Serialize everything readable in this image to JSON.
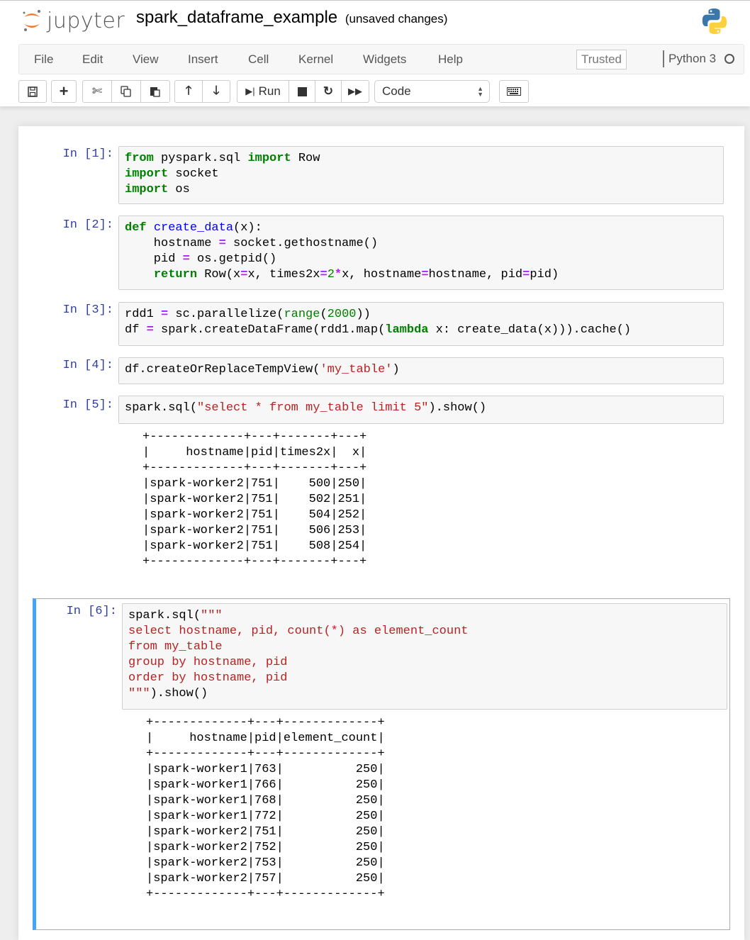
{
  "header": {
    "logo_text": "jupyter",
    "notebook_name": "spark_dataframe_example",
    "save_status": "(unsaved changes)",
    "kernel_logo": "python-logo-icon"
  },
  "menubar": {
    "items": [
      "File",
      "Edit",
      "View",
      "Insert",
      "Cell",
      "Kernel",
      "Widgets",
      "Help"
    ],
    "trusted_label": "Trusted",
    "kernel_name": "Python 3",
    "kernel_status_icon": "kernel-idle-circle-icon"
  },
  "toolbar": {
    "save_icon": "save-icon",
    "insert_icon": "plus-icon",
    "cut_icon": "scissors-icon",
    "copy_icon": "copy-icon",
    "paste_icon": "paste-icon",
    "move_up_icon": "arrow-up-icon",
    "move_down_icon": "arrow-down-icon",
    "run_label": "Run",
    "interrupt_icon": "stop-icon",
    "restart_icon": "restart-icon",
    "run_all_icon": "fast-forward-icon",
    "cell_type": "Code",
    "command_palette_icon": "keyboard-icon"
  },
  "cells": [
    {
      "prompt": "In [1]:",
      "lines": [
        [
          [
            "kw",
            "from"
          ],
          [
            "",
            "  pyspark.sql "
          ],
          [
            "kw",
            "import"
          ],
          [
            "",
            " Row"
          ]
        ],
        [
          [
            "kw",
            "import"
          ],
          [
            "",
            " socket"
          ]
        ],
        [
          [
            "kw",
            "import"
          ],
          [
            "",
            " os"
          ]
        ]
      ]
    },
    {
      "prompt": "In [2]:",
      "lines": [
        [
          [
            "kw",
            "def"
          ],
          [
            "",
            " "
          ],
          [
            "fn",
            "create_data"
          ],
          [
            "",
            "(x):"
          ]
        ],
        [
          [
            "",
            "    hostname "
          ],
          [
            "op",
            "="
          ],
          [
            "",
            " socket.gethostname()"
          ]
        ],
        [
          [
            "",
            "    pid "
          ],
          [
            "op",
            "="
          ],
          [
            "",
            " os.getpid()"
          ]
        ],
        [
          [
            "",
            "    "
          ],
          [
            "kw",
            "return"
          ],
          [
            "",
            " Row(x"
          ],
          [
            "op",
            "="
          ],
          [
            "",
            "x, times2x"
          ],
          [
            "op",
            "="
          ],
          [
            "num",
            "2"
          ],
          [
            "op",
            "*"
          ],
          [
            "",
            "x, hostname"
          ],
          [
            "op",
            "="
          ],
          [
            "",
            "hostname, pid"
          ],
          [
            "op",
            "="
          ],
          [
            "",
            "pid)"
          ]
        ]
      ]
    },
    {
      "prompt": "In [3]:",
      "lines": [
        [
          [
            "",
            "rdd1 "
          ],
          [
            "op",
            "="
          ],
          [
            "",
            " sc.parallelize("
          ],
          [
            "bi",
            "range"
          ],
          [
            "",
            "("
          ],
          [
            "num",
            "2000"
          ],
          [
            "",
            "))"
          ]
        ],
        [
          [
            "",
            "df "
          ],
          [
            "op",
            "="
          ],
          [
            "",
            " spark.createDataFrame(rdd1.map("
          ],
          [
            "kw",
            "lambda"
          ],
          [
            "",
            " x: create_data(x))).cache()"
          ]
        ]
      ]
    },
    {
      "prompt": "In [4]:",
      "lines": [
        [
          [
            "",
            "df.createOrReplaceTempView("
          ],
          [
            "str",
            "'my_table'"
          ],
          [
            "",
            ")"
          ]
        ]
      ]
    },
    {
      "prompt": "In [5]:",
      "lines": [
        [
          [
            "",
            "spark.sql("
          ],
          [
            "str",
            "\"select * from my_table limit 5\""
          ],
          [
            "",
            ").show()"
          ]
        ]
      ],
      "output": {
        "columns": [
          "hostname",
          "pid",
          "times2x",
          "x"
        ],
        "rows": [
          [
            "spark-worker2",
            "751",
            "500",
            "250"
          ],
          [
            "spark-worker2",
            "751",
            "502",
            "251"
          ],
          [
            "spark-worker2",
            "751",
            "504",
            "252"
          ],
          [
            "spark-worker2",
            "751",
            "506",
            "253"
          ],
          [
            "spark-worker2",
            "751",
            "508",
            "254"
          ]
        ]
      }
    },
    {
      "prompt": "In [6]:",
      "lines": [
        [
          [
            "",
            "spark.sql("
          ],
          [
            "str",
            "\"\"\""
          ]
        ],
        [
          [
            "str",
            "select hostname, pid, count(*) as element_count"
          ]
        ],
        [
          [
            "str",
            "from my_table"
          ]
        ],
        [
          [
            "str",
            "group by hostname, pid"
          ]
        ],
        [
          [
            "str",
            "order by hostname, pid"
          ]
        ],
        [
          [
            "str",
            "\"\"\""
          ],
          [
            "",
            ").show()"
          ]
        ]
      ],
      "output": {
        "columns": [
          "hostname",
          "pid",
          "element_count"
        ],
        "rows": [
          [
            "spark-worker1",
            "763",
            "250"
          ],
          [
            "spark-worker1",
            "766",
            "250"
          ],
          [
            "spark-worker1",
            "768",
            "250"
          ],
          [
            "spark-worker1",
            "772",
            "250"
          ],
          [
            "spark-worker2",
            "751",
            "250"
          ],
          [
            "spark-worker2",
            "752",
            "250"
          ],
          [
            "spark-worker2",
            "753",
            "250"
          ],
          [
            "spark-worker2",
            "757",
            "250"
          ]
        ]
      }
    }
  ]
}
